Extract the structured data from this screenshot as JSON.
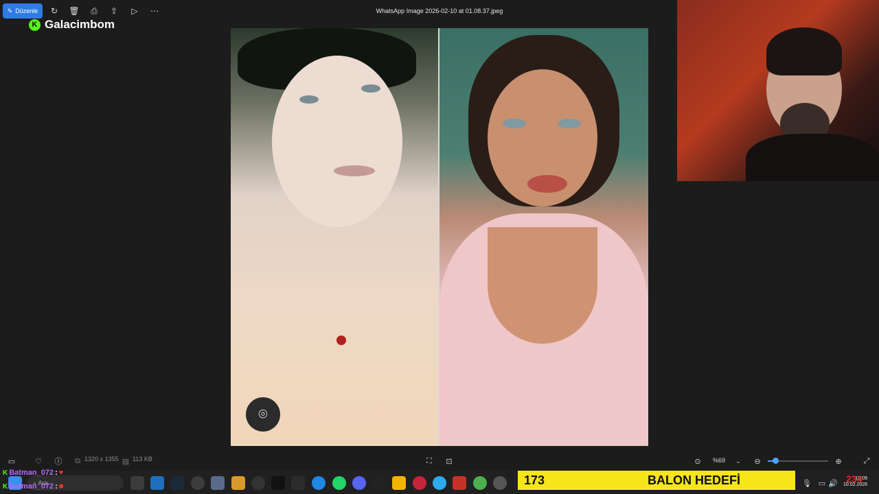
{
  "toolbar": {
    "edit_label": "Düzenle",
    "window_title": "WhatsApp Image 2026-02-10 at 01.08.37.jpeg"
  },
  "brand": {
    "badge": "K",
    "name": "Galacimbom"
  },
  "image": {
    "lens_icon": "visual-search-icon"
  },
  "info_bar": {
    "dimensions": "1320 x 1355",
    "file_size": "113 KB",
    "zoom": "%69",
    "zoom_level": 0.12
  },
  "chat": [
    {
      "name": "Batman_072",
      "colon": ":"
    },
    {
      "name": "Batman_072",
      "colon": ":"
    }
  ],
  "taskbar": {
    "search_placeholder": "Ara"
  },
  "goal": {
    "count": "173",
    "label": "BALON HEDEFİ"
  },
  "tray": {
    "overlay": "234",
    "time": "10:09",
    "date": "10.02.2026"
  },
  "colors": {
    "accent": "#2f7be5",
    "goal_bg": "#f5e61b",
    "kick_green": "#53fc18",
    "chat_name": "#b366ff"
  }
}
